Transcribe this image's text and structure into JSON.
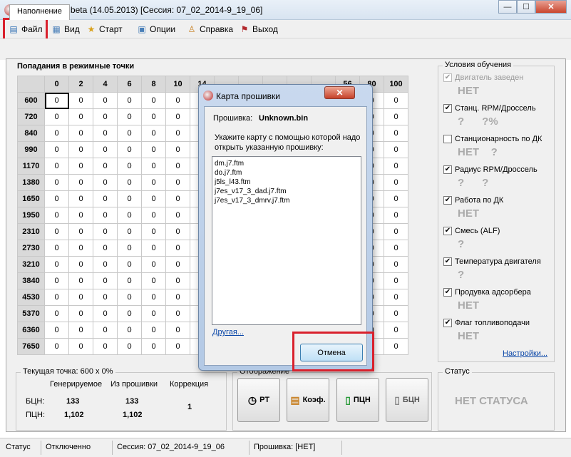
{
  "window": {
    "title": "FunTune 2.0 beta (14.05.2013) [Сессия: 07_02_2014-9_19_06]",
    "buttons": {
      "minimize": "—",
      "maximize": "☐",
      "close": "✕"
    }
  },
  "menu": [
    {
      "label": "Файл",
      "icon": "file-icon"
    },
    {
      "label": "Вид",
      "icon": "view-icon"
    },
    {
      "label": "Старт",
      "icon": "start-icon"
    },
    {
      "label": "Опции",
      "icon": "options-icon"
    },
    {
      "label": "Справка",
      "icon": "help-icon"
    },
    {
      "label": "Выход",
      "icon": "exit-icon"
    }
  ],
  "tab": {
    "label": "Наполнение"
  },
  "grid": {
    "title": "Попадания в режимные точки",
    "columns": [
      "0",
      "2",
      "4",
      "6",
      "8",
      "10",
      "14",
      "",
      "",
      "",
      "",
      "",
      "56",
      "80",
      "100"
    ],
    "rows": [
      "600",
      "720",
      "840",
      "990",
      "1170",
      "1380",
      "1650",
      "1950",
      "2310",
      "2730",
      "3210",
      "3840",
      "4530",
      "5370",
      "6360",
      "7650"
    ],
    "cell_value": "0"
  },
  "current_point": {
    "legend": "Текущая точка: 600 x 0%",
    "headers": [
      "Генерируемое",
      "Из прошивки",
      "Коррекция"
    ],
    "row1_label": "БЦН:",
    "row2_label": "ПЦН:",
    "gen_bcn": "133",
    "gen_pcn": "1,102",
    "fw_bcn": "133",
    "fw_pcn": "1,102",
    "correction": "1"
  },
  "display": {
    "legend": "Отображение",
    "buttons": [
      {
        "label": "РТ",
        "icon": "clock-icon"
      },
      {
        "label": "Коэф.",
        "icon": "coef-icon"
      },
      {
        "label": "ПЦН",
        "icon": "pcn-icon"
      },
      {
        "label": "БЦН",
        "icon": "bcn-icon"
      }
    ]
  },
  "conditions": {
    "legend": "Условия обучения",
    "items": [
      {
        "label": "Двигатель заведен",
        "checked": true,
        "disabled": true,
        "value": "НЕТ"
      },
      {
        "label": "Станц. RPM/Дроссель",
        "checked": true,
        "disabled": false,
        "value": "?      ?%"
      },
      {
        "label": "Станционарность по ДК",
        "checked": false,
        "disabled": false,
        "value": "НЕТ    ?"
      },
      {
        "label": "Радиус RPM/Дроссель",
        "checked": true,
        "disabled": false,
        "value": "?      ?"
      },
      {
        "label": "Работа по ДК",
        "checked": true,
        "disabled": false,
        "value": "НЕТ"
      },
      {
        "label": "Смесь (ALF)",
        "checked": true,
        "disabled": false,
        "value": "?"
      },
      {
        "label": "Температура двигателя",
        "checked": true,
        "disabled": false,
        "value": "?"
      },
      {
        "label": "Продувка адсорбера",
        "checked": true,
        "disabled": false,
        "value": "НЕТ"
      },
      {
        "label": "Флаг топливоподачи",
        "checked": true,
        "disabled": false,
        "value": "НЕТ"
      }
    ],
    "settings_link": "Настройки..."
  },
  "status_box": {
    "legend": "Статус",
    "value": "НЕТ СТАТУСА"
  },
  "statusbar": {
    "label": "Статус",
    "connection": "Отключенно",
    "session_label": "Сессия:",
    "session_value": "07_02_2014-9_19_06",
    "firmware_label": "Прошивка:",
    "firmware_value": "[НЕТ]"
  },
  "dialog": {
    "title": "Карта прошивки",
    "firmware_label": "Прошивка:",
    "firmware_name": "Unknown.bin",
    "instruction": "Укажите карту с помощью которой надо открыть указанную прошивку:",
    "files": [
      "dm.j7.ftm",
      "do.j7.ftm",
      "j5ls_l43.ftm",
      "j7es_v17_3_dad.j7.ftm",
      "j7es_v17_3_dmrv.j7.ftm"
    ],
    "other_link": "Другая...",
    "cancel": "Отмена",
    "close": "✕"
  },
  "colors": {
    "highlight": "#d9202c",
    "link": "#0b47a8",
    "muted_value": "#aaaaaa"
  }
}
